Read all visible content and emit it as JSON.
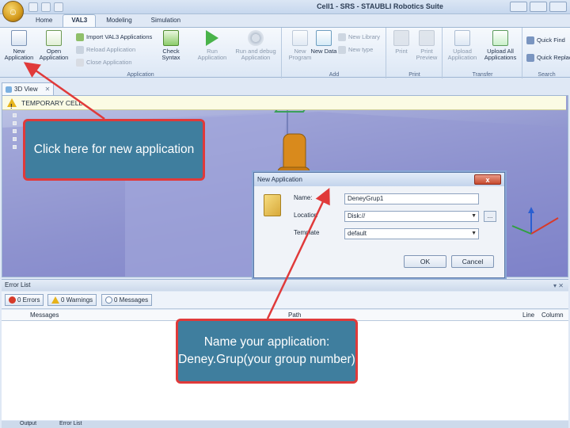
{
  "window": {
    "title": "Cell1 - SRS - STAUBLI Robotics Suite"
  },
  "tabs": [
    {
      "label": "Home",
      "active": false
    },
    {
      "label": "VAL3",
      "active": true
    },
    {
      "label": "Modeling",
      "active": false
    },
    {
      "label": "Simulation",
      "active": false
    }
  ],
  "ribbon": {
    "application": {
      "label": "Application",
      "new": "New Application",
      "open": "Open Application",
      "import": "Import VAL3 Applications",
      "reload": "Reload Application",
      "close": "Close Application",
      "check": "Check Syntax",
      "run": "Run Application",
      "run_debug": "Run and debug Application"
    },
    "add": {
      "label": "Add",
      "new_program": "New Program",
      "new_data": "New Data",
      "new_library": "New Library",
      "new_type": "New type"
    },
    "print": {
      "label": "Print",
      "print": "Print",
      "print_preview": "Print Preview"
    },
    "transfer": {
      "label": "Transfer",
      "upload": "Upload Application",
      "upload_all": "Upload All Applications"
    },
    "search": {
      "label": "Search",
      "quick_find": "Quick Find",
      "quick_replace": "Quick Replace"
    }
  },
  "view": {
    "tab_label": "3D View",
    "warning": "TEMPORARY CELL"
  },
  "dialog": {
    "title": "New Application",
    "name_label": "Name:",
    "name_value": "DeneyGrup1",
    "location_label": "Location",
    "location_value": "Disk://",
    "template_label": "Template",
    "template_value": "default",
    "browse": "...",
    "ok": "OK",
    "cancel": "Cancel",
    "close": "x"
  },
  "error_list": {
    "title": "Error List",
    "errors": "0 Errors",
    "warnings": "0 Warnings",
    "messages_filter": "0 Messages",
    "col_messages": "Messages",
    "col_path": "Path",
    "col_line": "Line",
    "col_column": "Column"
  },
  "bottom_tabs": {
    "output": "Output",
    "error_list": "Error List"
  },
  "callouts": {
    "new_app": "Click here for new application",
    "name_app": "Name your application: Deney.Grup(your group number)"
  },
  "colors": {
    "callout_fill": "#3f7e9e",
    "callout_border": "#e03a3a",
    "arrow": "#e03a3a"
  }
}
